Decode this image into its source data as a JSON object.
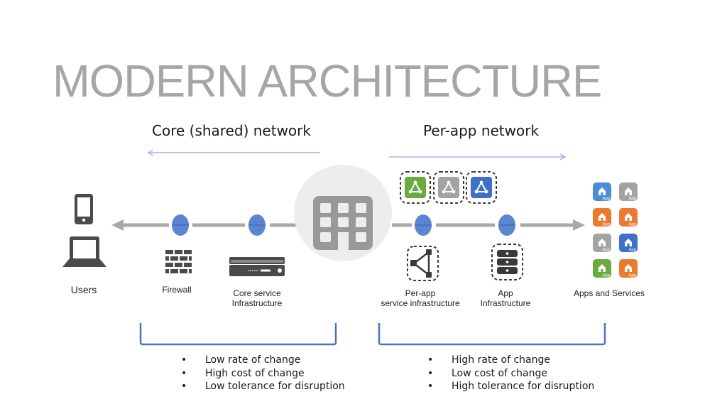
{
  "title": "MODERN ARCHITECTURE",
  "sections": {
    "core": {
      "heading": "Core (shared) network",
      "bullets": [
        "Low rate of change",
        "High cost of change",
        "Low tolerance for disruption"
      ]
    },
    "perapp": {
      "heading": "Per-app network",
      "bullets": [
        "High rate of change",
        "Low cost of change",
        "High tolerance for disruption"
      ]
    }
  },
  "nodes": {
    "users": {
      "label": "Users",
      "icons": [
        "phone-icon",
        "laptop-icon"
      ]
    },
    "firewall": {
      "label": "Firewall",
      "icon": "firewall-icon"
    },
    "core_service": {
      "label_line1": "Core service",
      "label_line2": "Infrastructure",
      "icon": "server-appliance-icon"
    },
    "hub": {
      "icon": "building-icon"
    },
    "perapp_service": {
      "label_line1": "Per-app",
      "label_line2": "service infrastructure",
      "icon": "service-mesh-icon"
    },
    "app_infra": {
      "label_line1": "App",
      "label_line2": "Infrastructure",
      "icon": "server-stack-icon"
    },
    "apps": {
      "label": "Apps and Services",
      "tile_text": "App"
    }
  },
  "service_tiles": [
    {
      "color": "#6aab3f"
    },
    {
      "color": "#a3a3a3"
    },
    {
      "color": "#3f6fc7"
    }
  ],
  "app_tiles": [
    {
      "color": "#4a8fd6"
    },
    {
      "color": "#a3a3a3"
    },
    {
      "color": "#ea7a30"
    },
    {
      "color": "#ea7a30"
    },
    {
      "color": "#a3a3a3"
    },
    {
      "color": "#3f6fc7"
    },
    {
      "color": "#6aab3f"
    },
    {
      "color": "#ea7a30"
    }
  ],
  "colors": {
    "title": "#a6a6a6",
    "node_dot": "#5b85d1",
    "line": "#a8a8a8",
    "bracket": "#4872c4",
    "direction_arrow": "#8faadc",
    "icon_dark": "#4a4a4a"
  }
}
